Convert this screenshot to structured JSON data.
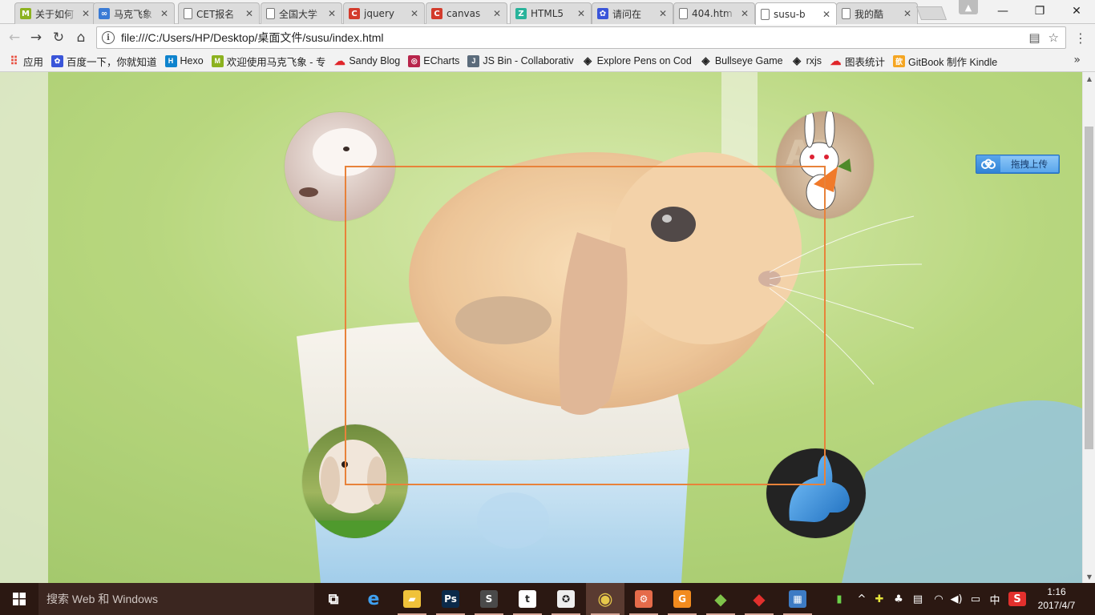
{
  "tabs": [
    {
      "title": "关于如何",
      "favicon": "green-m-icon",
      "color": "#8cb21f",
      "glyph": "M"
    },
    {
      "title": "马克飞象",
      "favicon": "baidu-cloud-icon",
      "color": "#3a7bd5",
      "glyph": "∞"
    },
    {
      "title": "CET报名",
      "favicon": "page-icon",
      "color": "#ffffff",
      "glyph": ""
    },
    {
      "title": "全国大学",
      "favicon": "page-icon",
      "color": "#ffffff",
      "glyph": ""
    },
    {
      "title": "jquery",
      "favicon": "red-c-icon",
      "color": "#d33b2c",
      "glyph": "C"
    },
    {
      "title": "canvas",
      "favicon": "red-c-icon",
      "color": "#d33b2c",
      "glyph": "C"
    },
    {
      "title": "HTML5",
      "favicon": "z-icon",
      "color": "#28b39a",
      "glyph": "Z"
    },
    {
      "title": "请问在",
      "favicon": "baidu-paw-icon",
      "color": "#3a55d9",
      "glyph": "✿"
    },
    {
      "title": "404.htm",
      "favicon": "page-icon",
      "color": "#ffffff",
      "glyph": ""
    },
    {
      "title": "susu-b",
      "favicon": "page-icon",
      "color": "#ffffff",
      "glyph": "",
      "active": true
    },
    {
      "title": "我的酷",
      "favicon": "page-icon",
      "color": "#ffffff",
      "glyph": ""
    }
  ],
  "toolbar": {
    "url": "file:///C:/Users/HP/Desktop/桌面文件/susu/index.html",
    "back_icon": "arrow-left-icon",
    "forward_icon": "arrow-right-icon",
    "reload_icon": "reload-icon",
    "home_icon": "home-icon"
  },
  "bookmarks": [
    {
      "label": "应用",
      "icon": "apps-grid-icon",
      "color": "#e84b3c",
      "glyph": "⠿"
    },
    {
      "label": "百度一下，你就知道",
      "icon": "baidu-paw-icon",
      "color": "#3a55d9",
      "glyph": "✿"
    },
    {
      "label": "Hexo",
      "icon": "hexo-icon",
      "color": "#0e83cd",
      "glyph": "H"
    },
    {
      "label": "欢迎使用马克飞象 - 专",
      "icon": "green-m-icon",
      "color": "#8cb21f",
      "glyph": "M"
    },
    {
      "label": "Sandy Blog",
      "icon": "red-cloud-icon",
      "color": "#e0262b",
      "glyph": "☁"
    },
    {
      "label": "ECharts",
      "icon": "echarts-icon",
      "color": "#b8254b",
      "glyph": "◎"
    },
    {
      "label": "JS Bin - Collaborativ",
      "icon": "jsbin-icon",
      "color": "#5b6b7b",
      "glyph": "J"
    },
    {
      "label": "Explore Pens on Cod",
      "icon": "codepen-icon",
      "color": "#222222",
      "glyph": "◈"
    },
    {
      "label": "Bullseye Game",
      "icon": "codepen-icon",
      "color": "#222222",
      "glyph": "◈"
    },
    {
      "label": "rxjs",
      "icon": "codepen-icon",
      "color": "#222222",
      "glyph": "◈"
    },
    {
      "label": "图表统计",
      "icon": "red-cloud-icon",
      "color": "#e0262b",
      "glyph": "☁"
    },
    {
      "label": "GitBook 制作 Kindle",
      "icon": "gitbook-icon",
      "color": "#f5a623",
      "glyph": "歆"
    }
  ],
  "page": {
    "upload_label": "拖拽上传",
    "frame_color": "#e8823a",
    "avatars": [
      {
        "name": "avatar-fluffy-rabbit"
      },
      {
        "name": "avatar-cartoon-rabbit"
      },
      {
        "name": "avatar-lop-rabbit"
      },
      {
        "name": "avatar-blue-rabbit-logo"
      }
    ]
  },
  "taskbar": {
    "search_placeholder": "搜索 Web 和 Windows",
    "apps": [
      {
        "name": "task-view-icon",
        "glyph": "⧉",
        "color": "transparent"
      },
      {
        "name": "edge-icon",
        "glyph": "e",
        "color": "transparent"
      },
      {
        "name": "file-explorer-icon",
        "glyph": "▰",
        "color": "#f0c23a"
      },
      {
        "name": "photoshop-icon",
        "glyph": "Ps",
        "color": "#0b2a4a"
      },
      {
        "name": "sublime-icon",
        "glyph": "S",
        "color": "#4a4a4a"
      },
      {
        "name": "tumblr-icon",
        "glyph": "t",
        "color": "#ffffff"
      },
      {
        "name": "compass-icon",
        "glyph": "✪",
        "color": "#eeeeee"
      },
      {
        "name": "chrome-icon",
        "glyph": "◉",
        "color": "transparent"
      },
      {
        "name": "settings-app-icon",
        "glyph": "⚙",
        "color": "#e56b4a"
      },
      {
        "name": "grunt-icon",
        "glyph": "G",
        "color": "#f28b1e"
      },
      {
        "name": "git-icon",
        "glyph": "◆",
        "color": "transparent"
      },
      {
        "name": "red-diamond-icon",
        "glyph": "◆",
        "color": "transparent"
      },
      {
        "name": "building-icon",
        "glyph": "▦",
        "color": "#3d7bc4"
      }
    ],
    "tray": [
      {
        "name": "battery-icon",
        "glyph": "▮"
      },
      {
        "name": "chevron-up-icon",
        "glyph": "^"
      },
      {
        "name": "plus-badge-icon",
        "glyph": "✚"
      },
      {
        "name": "penguin-icon",
        "glyph": "♣"
      },
      {
        "name": "keyboard-icon",
        "glyph": "▤"
      },
      {
        "name": "wifi-icon",
        "glyph": "◠"
      },
      {
        "name": "volume-icon",
        "glyph": "◀)"
      },
      {
        "name": "notification-icon",
        "glyph": "▭"
      },
      {
        "name": "ime-label",
        "glyph": "中"
      },
      {
        "name": "sogou-icon",
        "glyph": "S"
      }
    ],
    "time": "1:16",
    "date": "2017/4/7"
  }
}
